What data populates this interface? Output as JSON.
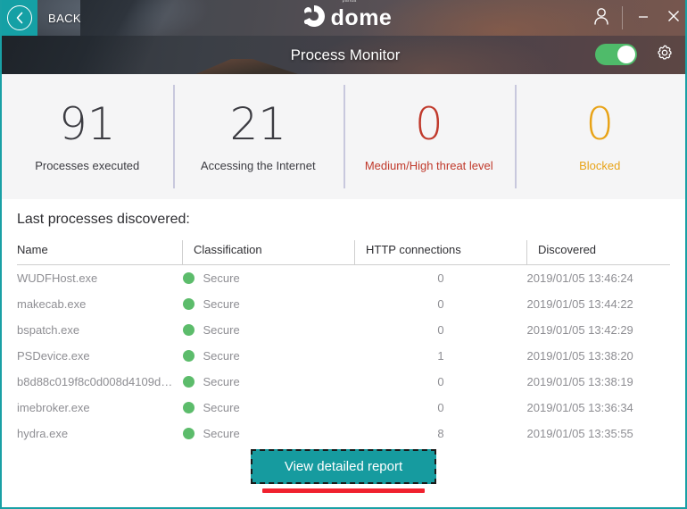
{
  "window": {
    "back_label": "BACK",
    "logo_sup": "panda",
    "logo_text": "dome",
    "account_icon": "user-icon",
    "minimize_label": "–",
    "close_label": "×"
  },
  "subheader": {
    "title": "Process Monitor",
    "toggle_state": "on",
    "settings_icon": "gear-icon"
  },
  "stats": [
    {
      "value": "91",
      "label": "Processes executed",
      "color": "#3c3c42"
    },
    {
      "value": "21",
      "label": "Accessing the Internet",
      "color": "#3c3c42"
    },
    {
      "value": "0",
      "label": "Medium/High threat level",
      "color": "#c0392b"
    },
    {
      "value": "0",
      "label": "Blocked",
      "color": "#e8a317"
    }
  ],
  "main": {
    "section_title": "Last processes discovered:",
    "columns": [
      "Name",
      "Classification",
      "HTTP connections",
      "Discovered"
    ],
    "rows": [
      {
        "name": "WUDFHost.exe",
        "classification": "Secure",
        "status_color": "#5cbc6b",
        "http": "0",
        "discovered": "2019/01/05 13:46:24"
      },
      {
        "name": "makecab.exe",
        "classification": "Secure",
        "status_color": "#5cbc6b",
        "http": "0",
        "discovered": "2019/01/05 13:44:22"
      },
      {
        "name": "bspatch.exe",
        "classification": "Secure",
        "status_color": "#5cbc6b",
        "http": "0",
        "discovered": "2019/01/05 13:42:29"
      },
      {
        "name": "PSDevice.exe",
        "classification": "Secure",
        "status_color": "#5cbc6b",
        "http": "1",
        "discovered": "2019/01/05 13:38:20"
      },
      {
        "name": "b8d88c019f8c0d008d4109d…",
        "classification": "Secure",
        "status_color": "#5cbc6b",
        "http": "0",
        "discovered": "2019/01/05 13:38:19"
      },
      {
        "name": "imebroker.exe",
        "classification": "Secure",
        "status_color": "#5cbc6b",
        "http": "0",
        "discovered": "2019/01/05 13:36:34"
      },
      {
        "name": "hydra.exe",
        "classification": "Secure",
        "status_color": "#5cbc6b",
        "http": "8",
        "discovered": "2019/01/05 13:35:55"
      }
    ]
  },
  "footer": {
    "report_button": "View detailed report"
  },
  "colors": {
    "accent_teal": "#169b9f",
    "toggle_green": "#4fbb6a",
    "status_green": "#5cbc6b",
    "threat_red": "#c0392b",
    "blocked_orange": "#e8a317",
    "annotation_red": "#f0212e"
  }
}
